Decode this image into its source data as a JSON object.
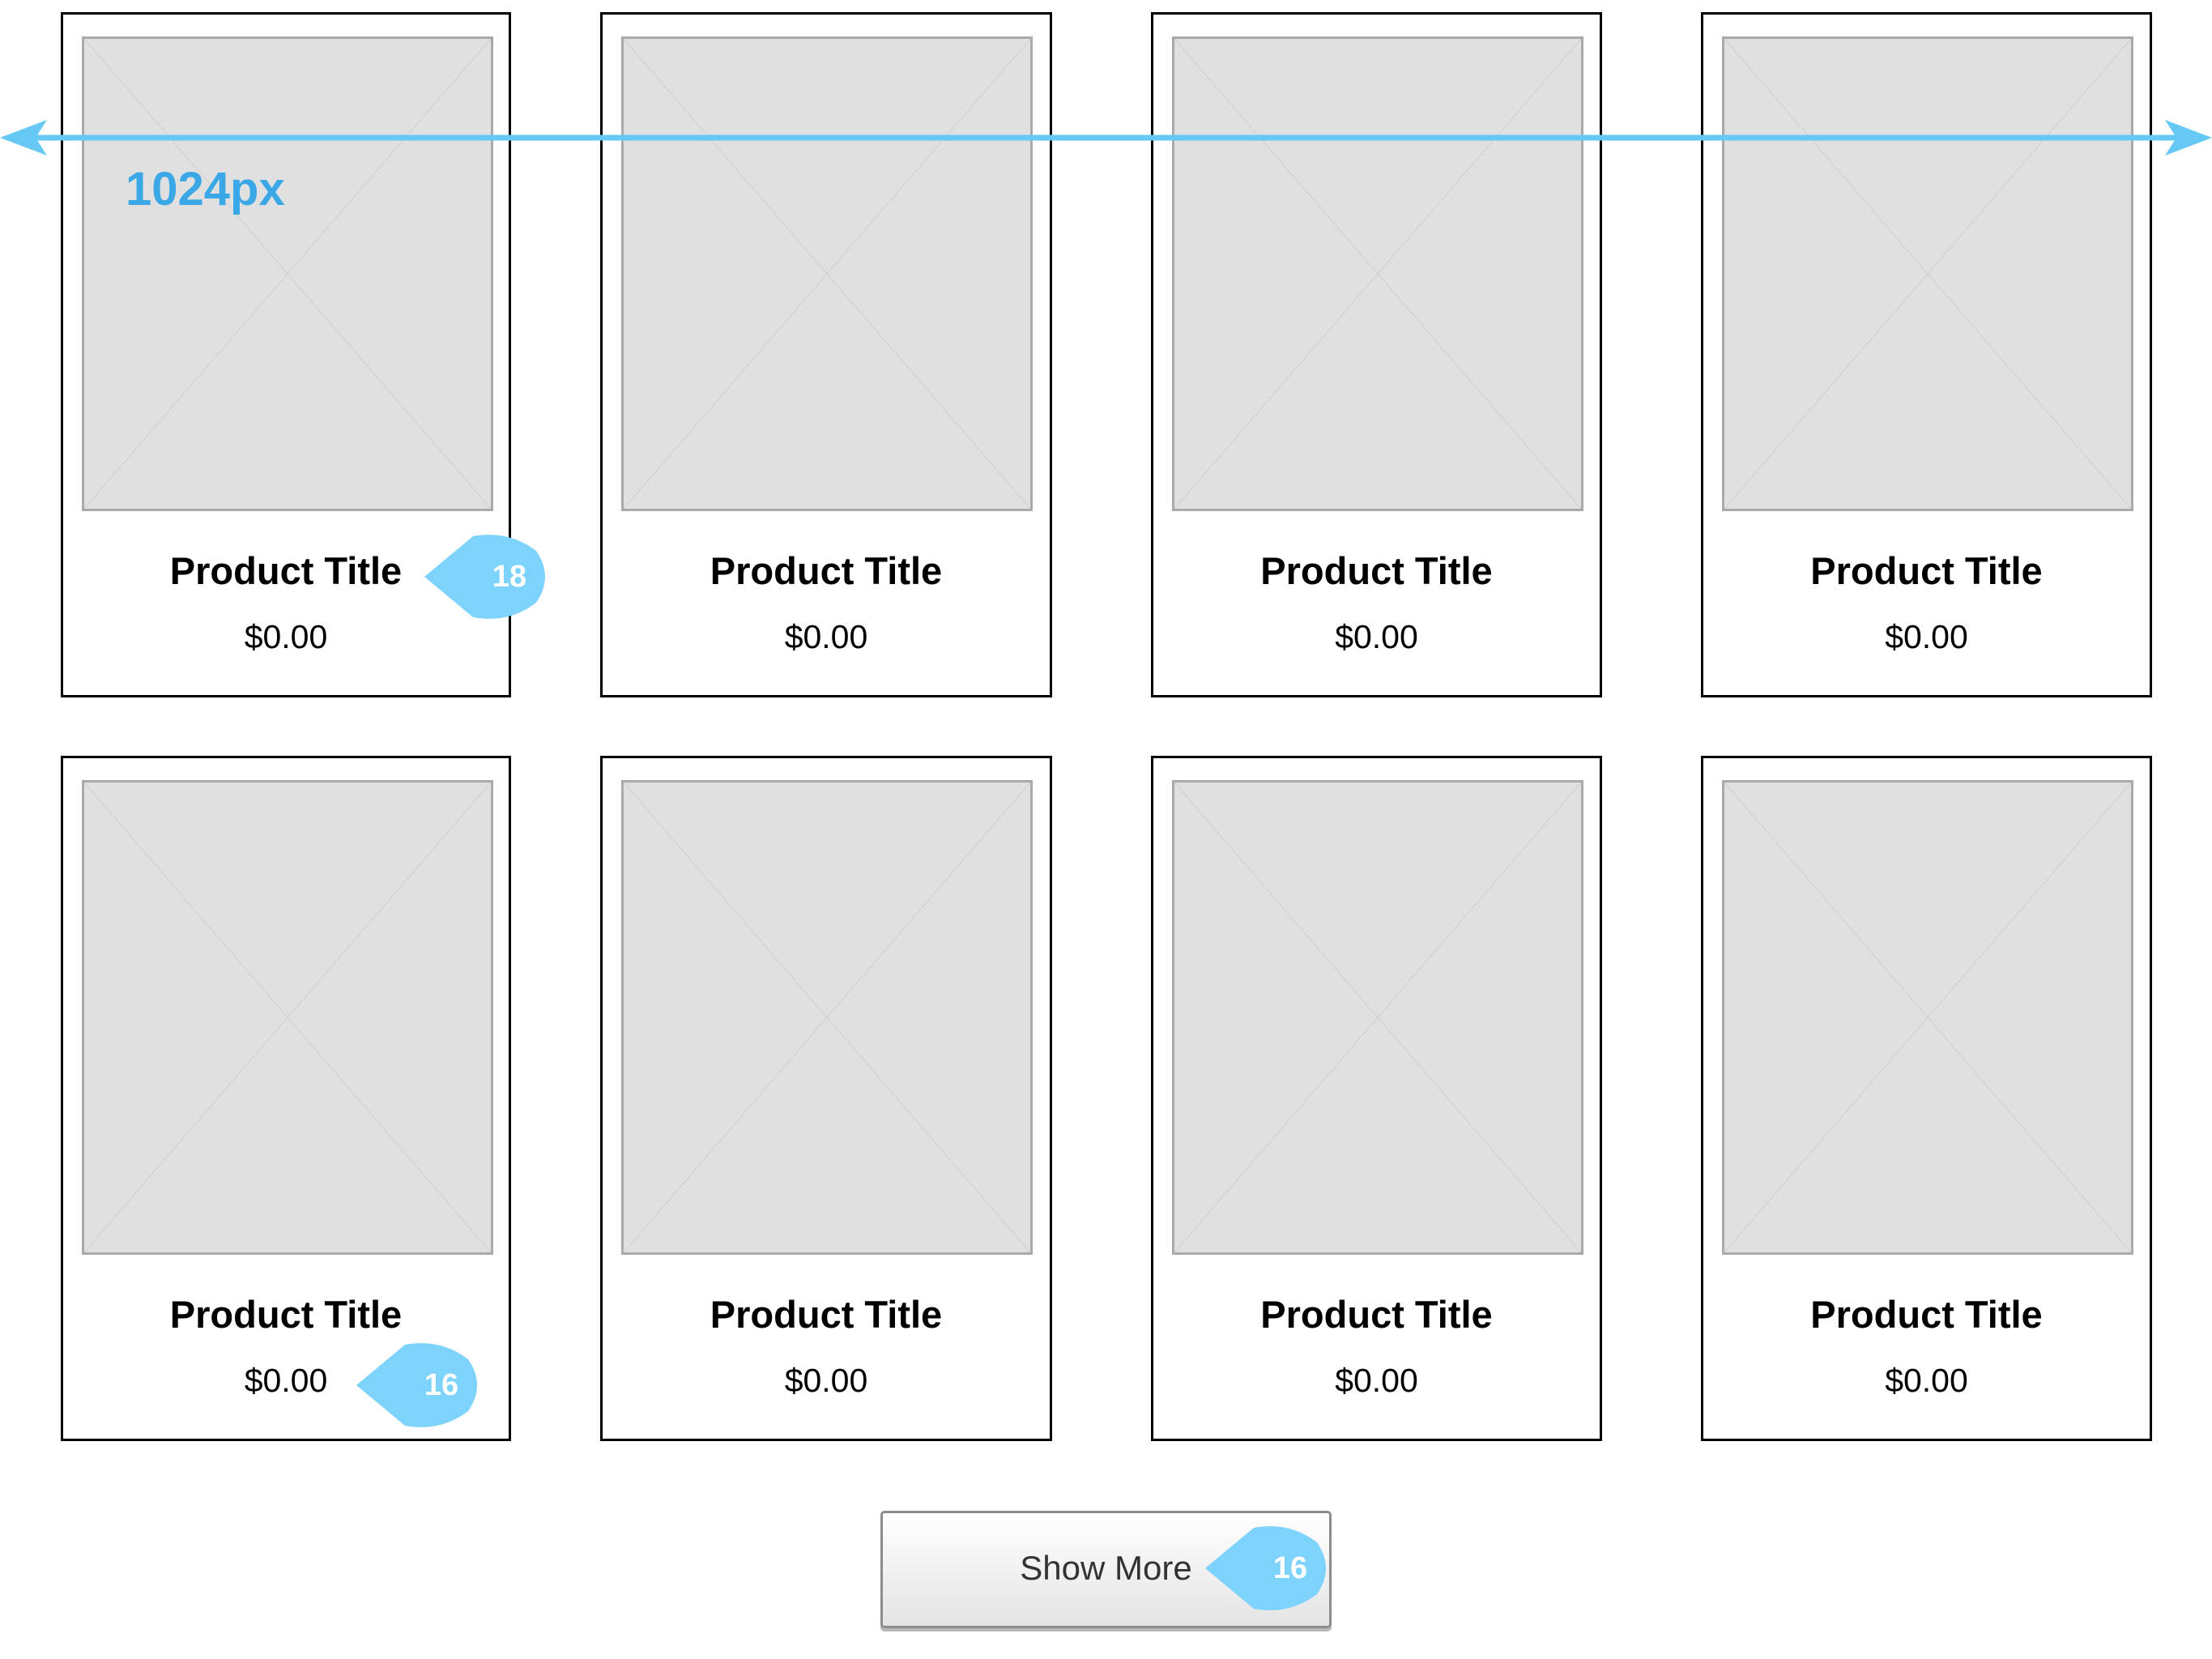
{
  "measurement": {
    "label": "1024px",
    "color": "#66c8f5",
    "label_color": "#3aa8e6"
  },
  "products": [
    {
      "title": "Product Title",
      "price": "$0.00"
    },
    {
      "title": "Product Title",
      "price": "$0.00"
    },
    {
      "title": "Product Title",
      "price": "$0.00"
    },
    {
      "title": "Product Title",
      "price": "$0.00"
    },
    {
      "title": "Product Title",
      "price": "$0.00"
    },
    {
      "title": "Product Title",
      "price": "$0.00"
    },
    {
      "title": "Product Title",
      "price": "$0.00"
    },
    {
      "title": "Product Title",
      "price": "$0.00"
    }
  ],
  "annotations": {
    "title_font_size": "18",
    "price_font_size": "16",
    "button_font_size": "16",
    "color": "#7dd3fc"
  },
  "show_more": {
    "label": "Show More"
  }
}
